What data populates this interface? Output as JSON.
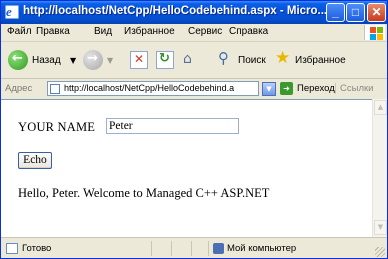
{
  "window": {
    "title": "http://localhost/NetCpp/HelloCodebehind.aspx - Micro..."
  },
  "menu": [
    "Файл",
    "Правка",
    "Вид",
    "Избранное",
    "Сервис",
    "Справка"
  ],
  "toolbar": {
    "back_label": "Назад",
    "search_label": "Поиск",
    "favorites_label": "Избранное"
  },
  "address": {
    "label": "Адрес",
    "url": "http://localhost/NetCpp/HelloCodebehind.a",
    "go_label": "Переход",
    "links_label": "Ссылки"
  },
  "page": {
    "name_label": "YOUR NAME",
    "name_value": "Peter",
    "echo_label": "Echo",
    "greeting": "Hello, Peter. Welcome to Managed C++ ASP.NET"
  },
  "status": {
    "text": "Готово",
    "zone": "Мой компьютер"
  },
  "colors": {
    "titlebar": "#0551d8",
    "chrome": "#ece9d8",
    "close_button": "#c83a1b"
  }
}
